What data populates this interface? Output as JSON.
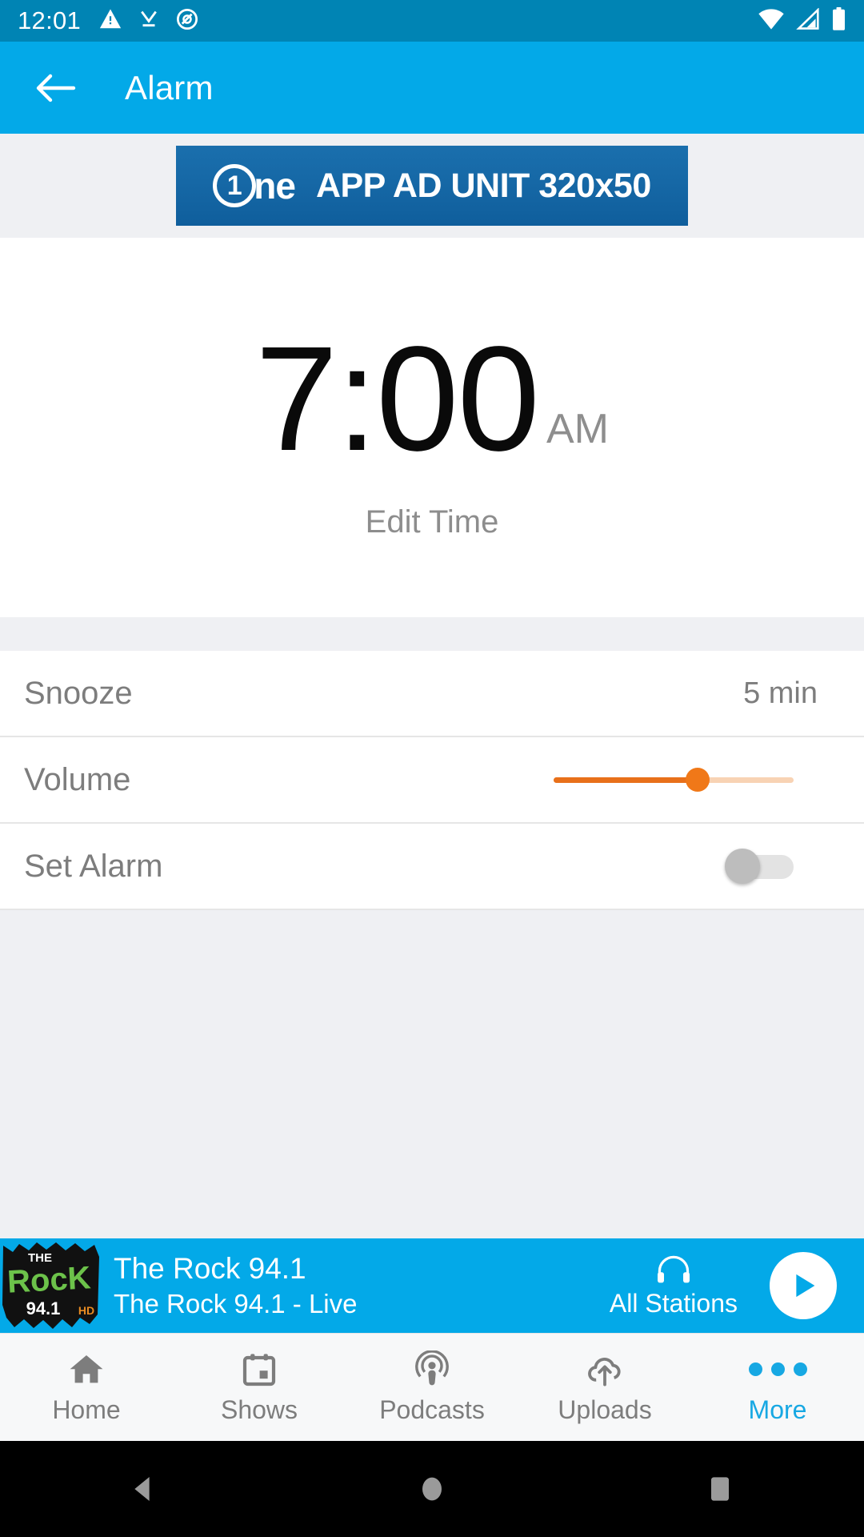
{
  "statusbar": {
    "time": "12:01",
    "icons_left": [
      "warning-icon",
      "download-done-icon",
      "do-not-disturb-icon"
    ],
    "icons_right": [
      "wifi-icon",
      "cellular-signal-icon",
      "battery-icon"
    ]
  },
  "appbar": {
    "back_icon": "arrow-back-icon",
    "title": "Alarm"
  },
  "ad": {
    "logo_digit": "1",
    "logo_word": "ne",
    "text": "APP AD UNIT 320x50"
  },
  "alarm": {
    "time": "7:00",
    "meridiem": "AM",
    "edit_label": "Edit Time"
  },
  "settings": {
    "rows": [
      {
        "label": "Snooze",
        "value": "5 min",
        "control": "value"
      },
      {
        "label": "Volume",
        "value": "",
        "control": "slider"
      },
      {
        "label": "Set Alarm",
        "value": "",
        "control": "toggle"
      }
    ],
    "volume_percent": 60,
    "set_alarm_on": false,
    "slider_color": "#e8701a",
    "slider_track_color": "#f8d3b4"
  },
  "player": {
    "station_logo": {
      "the": "THE",
      "rock": "RocK",
      "freq": "94.1",
      "hd": "HD"
    },
    "title": "The Rock 94.1",
    "subtitle": "The Rock 94.1  - Live",
    "all_stations_label": "All Stations",
    "all_stations_icon": "headphones-icon",
    "play_icon": "play-icon",
    "bar_color": "#03a9e8"
  },
  "bottomnav": {
    "items": [
      {
        "label": "Home",
        "icon": "home-icon",
        "active": false
      },
      {
        "label": "Shows",
        "icon": "calendar-icon",
        "active": false
      },
      {
        "label": "Podcasts",
        "icon": "podcast-icon",
        "active": false
      },
      {
        "label": "Uploads",
        "icon": "cloud-upload-icon",
        "active": false
      },
      {
        "label": "More",
        "icon": "more-dots-icon",
        "active": true
      }
    ],
    "active_color": "#17a8e3",
    "inactive_color": "#7d7d7d"
  },
  "sysnav": {
    "back_icon": "system-back-icon",
    "home_icon": "system-home-icon",
    "recents_icon": "system-recents-icon"
  }
}
